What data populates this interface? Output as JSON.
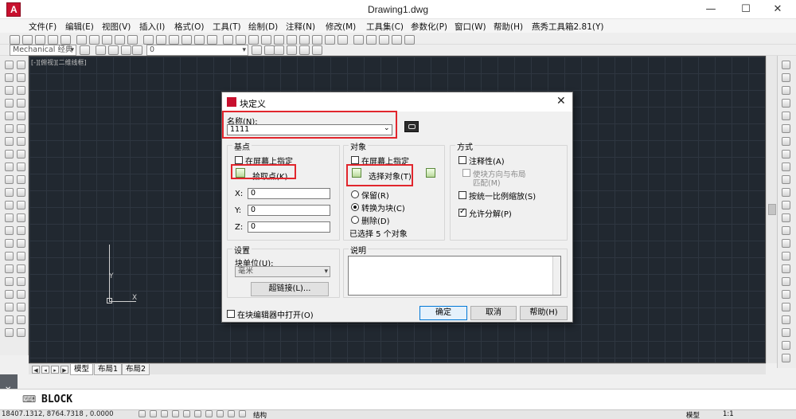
{
  "window": {
    "title": "Drawing1.dwg",
    "minimize": "—",
    "maximize": "☐",
    "close": "✕"
  },
  "menubar": [
    "文件(F)",
    "编辑(E)",
    "视图(V)",
    "插入(I)",
    "格式(O)",
    "工具(T)",
    "绘制(D)",
    "注释(N)",
    "修改(M)",
    "工具集(C)",
    "参数化(P)",
    "窗口(W)",
    "帮助(H)",
    "燕秀工具箱2.81(Y)"
  ],
  "toolbar": {
    "workspace": "Mechanical 经典",
    "layer_value": "0"
  },
  "canvas": {
    "viewport_label": "[-][俯视][二维线框]",
    "ucs_x": "X",
    "ucs_y": "Y"
  },
  "layout_tabs": [
    "模型",
    "布局1",
    "布局2"
  ],
  "command": {
    "text": "BLOCK",
    "close": "✕"
  },
  "status": {
    "coords": "18407.1312, 8764.7318 , 0.0000",
    "model_label": "模型",
    "extra": "结构",
    "zoom": "1:1"
  },
  "dialog": {
    "title": "块定义",
    "close": "✕",
    "name_label": "名称(N):",
    "name_value": "1111",
    "base_point": {
      "title": "基点",
      "specify_on_screen": "在屏幕上指定",
      "pick_point": "拾取点(K)",
      "x_label": "X:",
      "x_value": "0",
      "y_label": "Y:",
      "y_value": "0",
      "z_label": "Z:",
      "z_value": "0"
    },
    "objects": {
      "title": "对象",
      "specify_on_screen": "在屏幕上指定",
      "select_objects": "选择对象(T)",
      "retain": "保留(R)",
      "convert": "转换为块(C)",
      "delete": "删除(D)",
      "selected_info": "已选择 5 个对象"
    },
    "behavior": {
      "title": "方式",
      "annotative": "注释性(A)",
      "match_orientation": "使块方向与布局",
      "match_orientation_2": "匹配(M)",
      "scale_uniformly": "按统一比例缩放(S)",
      "allow_exploding": "允许分解(P)"
    },
    "settings": {
      "title": "设置",
      "block_unit_label": "块单位(U):",
      "block_unit_value": "毫米",
      "hyperlink": "超链接(L)..."
    },
    "description": {
      "title": "说明"
    },
    "open_in_editor": "在块编辑器中打开(O)",
    "ok": "确定",
    "cancel": "取消",
    "help": "帮助(H)"
  },
  "colors": {
    "canvas_bg": "#212830",
    "highlight_box": "#e1262d",
    "brand_red": "#c8102e"
  }
}
